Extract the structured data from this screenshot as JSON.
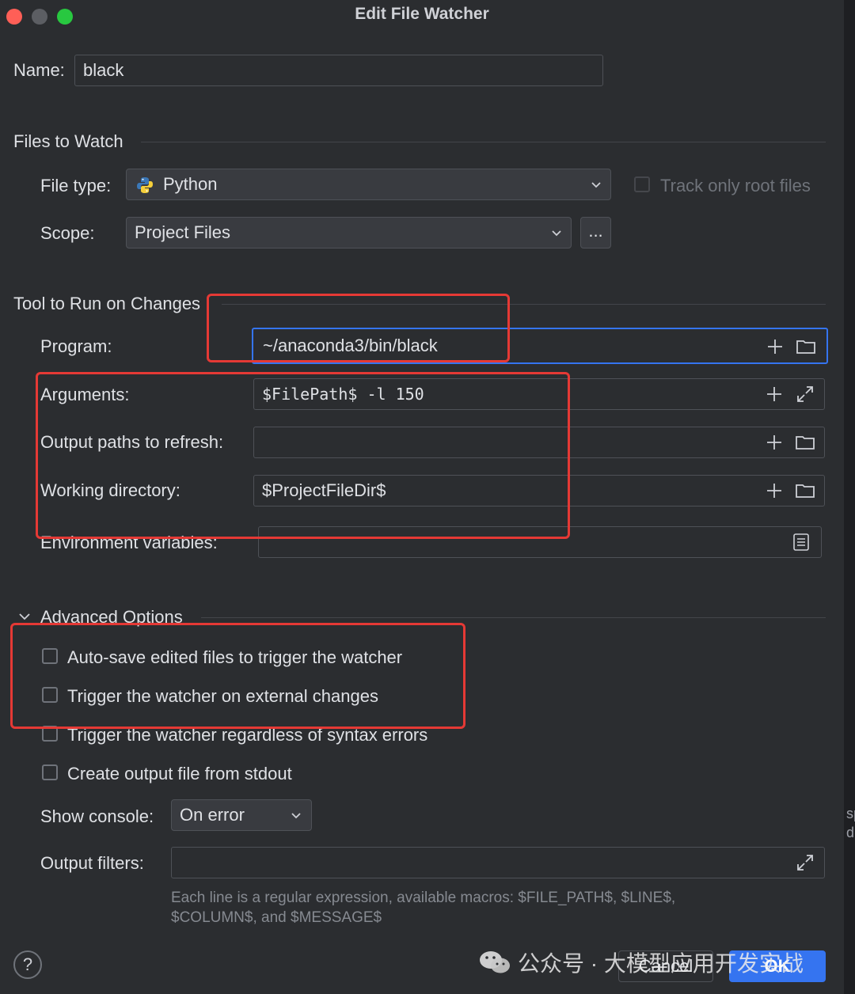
{
  "window": {
    "title": "Edit File Watcher"
  },
  "name_field": {
    "label": "Name:",
    "value": "black"
  },
  "files_to_watch": {
    "section_title": "Files to Watch",
    "file_type": {
      "label": "File type:",
      "value": "Python"
    },
    "track_only_root": {
      "label": "Track only root files",
      "checked": false,
      "enabled": false
    },
    "scope": {
      "label": "Scope:",
      "value": "Project Files",
      "more_button": "..."
    }
  },
  "tool": {
    "section_title": "Tool to Run on Changes",
    "program": {
      "label": "Program:",
      "value": "~/anaconda3/bin/black"
    },
    "arguments": {
      "label": "Arguments:",
      "value": "$FilePath$ -l 150"
    },
    "output_paths": {
      "label": "Output paths to refresh:",
      "value": ""
    },
    "working_dir": {
      "label": "Working directory:",
      "value": "$ProjectFileDir$"
    },
    "env_vars": {
      "label": "Environment variables:",
      "value": ""
    }
  },
  "advanced": {
    "section_title": "Advanced Options",
    "options": [
      {
        "label": "Auto-save edited files to trigger the watcher",
        "checked": false
      },
      {
        "label": "Trigger the watcher on external changes",
        "checked": false
      },
      {
        "label": "Trigger the watcher regardless of syntax errors",
        "checked": false
      },
      {
        "label": "Create output file from stdout",
        "checked": false
      }
    ],
    "show_console": {
      "label": "Show console:",
      "value": "On error"
    },
    "output_filters": {
      "label": "Output filters:",
      "value": "",
      "hint_line1": "Each line is a regular expression, available macros: $FILE_PATH$, $LINE$,",
      "hint_line2": "$COLUMN$, and $MESSAGE$"
    }
  },
  "footer": {
    "help": "?",
    "cancel": "Cancel",
    "ok": "OK"
  },
  "watermark": {
    "text": "公众号 · 大模型应用开发实战"
  },
  "right_edge": {
    "chars": [
      "sp",
      "di"
    ]
  },
  "colors": {
    "accent": "#3574f0",
    "highlight_box": "#e53935",
    "background": "#2b2d30"
  }
}
